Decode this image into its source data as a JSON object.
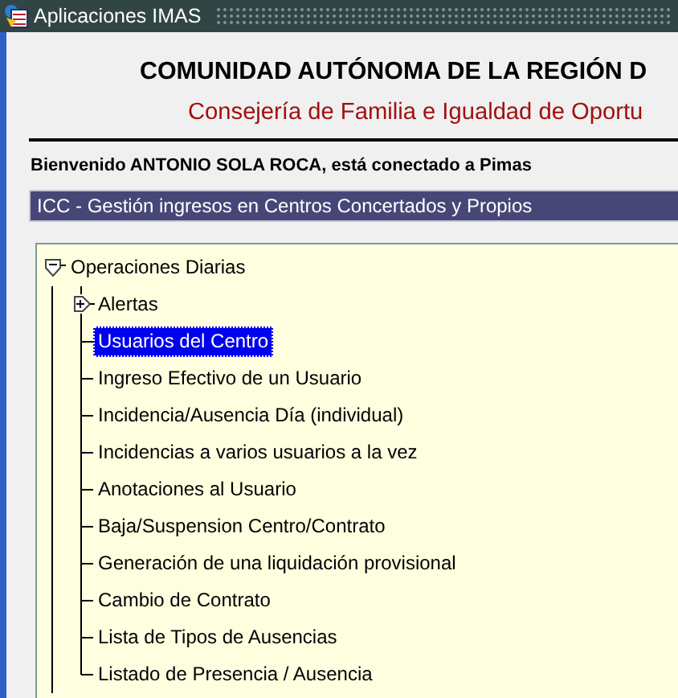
{
  "window": {
    "title": "Aplicaciones IMAS"
  },
  "header": {
    "title": "COMUNIDAD AUTÓNOMA DE LA REGIÓN D",
    "subtitle": "Consejería de Familia e Igualdad de Oportu"
  },
  "welcome": "Bienvenido ANTONIO SOLA ROCA, está conectado a Pimas",
  "application": "ICC - Gestión ingresos en Centros Concertados y Propios",
  "menu_tree": [
    {
      "label": "Operaciones Diarias",
      "expanded": true,
      "selected": false,
      "children": [
        {
          "label": "Alertas",
          "expanded": false,
          "selected": false
        },
        {
          "label": "Usuarios del Centro",
          "selected": true
        },
        {
          "label": "Ingreso Efectivo de un Usuario",
          "selected": false
        },
        {
          "label": "Incidencia/Ausencia Día (individual)",
          "selected": false
        },
        {
          "label": "Incidencias a varios usuarios a la vez",
          "selected": false
        },
        {
          "label": "Anotaciones al Usuario",
          "selected": false
        },
        {
          "label": "Baja/Suspension Centro/Contrato",
          "selected": false
        },
        {
          "label": "Generación de una liquidación provisional",
          "selected": false
        },
        {
          "label": "Cambio de Contrato",
          "selected": false
        },
        {
          "label": "Lista de Tipos de Ausencias",
          "selected": false
        },
        {
          "label": "Listado de Presencia / Ausencia",
          "selected": false
        }
      ]
    }
  ]
}
